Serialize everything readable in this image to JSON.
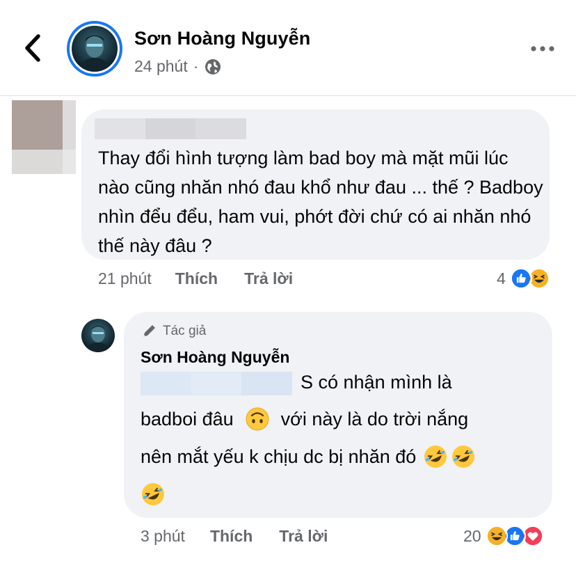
{
  "header": {
    "name": "Sơn Hoàng Nguyễn",
    "time": "24 phút",
    "separator": "·"
  },
  "comment1": {
    "text": "Thay đổi hình tượng làm bad boy mà mặt mũi lúc nào cũng nhăn nhó đau khổ như đau ... thế ? Badboy nhìn đểu đểu, ham vui, phớt đời chứ có ai nhăn nhó thế này đâu ?",
    "time": "21 phút",
    "like_label": "Thích",
    "reply_label": "Trả lời",
    "reaction_count": "4",
    "reactions": [
      "like-icon",
      "haha-icon"
    ]
  },
  "reply": {
    "badge": "Tác giả",
    "name": "Sơn Hoàng Nguyễn",
    "line1": "S có nhận mình là",
    "line2": "badboi đâu",
    "line2b": "với này là do trời nắng",
    "line3": "nên mắt yếu k chịu dc bị nhăn đó",
    "time": "3 phút",
    "like_label": "Thích",
    "reply_label": "Trả lời",
    "reaction_count": "20",
    "reactions": [
      "haha-icon",
      "like-icon",
      "love-icon"
    ]
  },
  "colors": {
    "accent": "#1877f2",
    "bubble": "#f0f2f5",
    "secondary_text": "#65676b",
    "love": "#f33e58",
    "haha": "#f7b125"
  }
}
